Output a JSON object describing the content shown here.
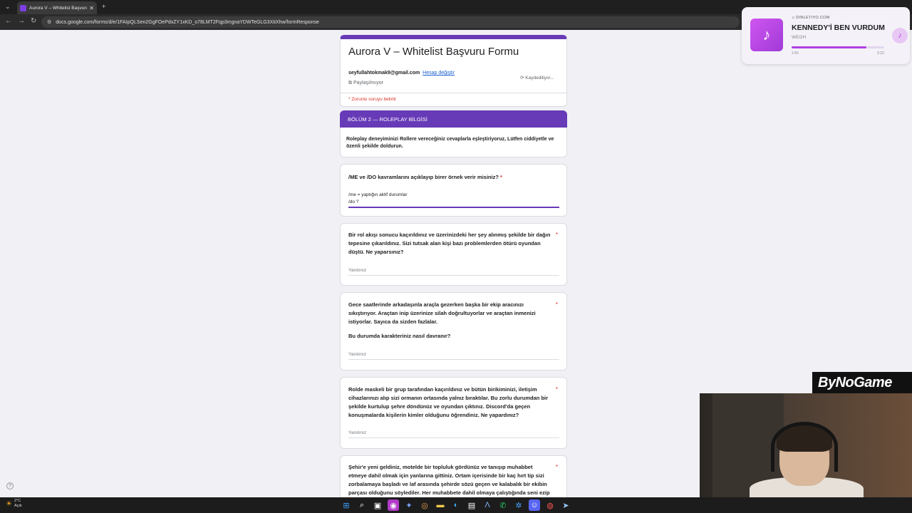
{
  "browser": {
    "tab_title": "Aurora V – Whitelist Başvuru Fo",
    "url": "docs.google.com/forms/d/e/1FAIpQLSen2GgFOePdxZY1xKD_o78LMT2Fqp3mgnaYDWTeGLG3XtiXhw/formResponse",
    "accent_color": "#673ab7"
  },
  "form": {
    "title": "Aurora V  – Whitelist Başvuru Formu",
    "email": "seyfullahtokmak9@gmail.com",
    "switch_account": "Hesap değiştir",
    "not_shared": "Paylaşılmıyor",
    "saving": "Kaydediliyor...",
    "required_note": "* Zorunlu soruyu belirtir",
    "section_title": "BÖLÜM 2 — ROLEPLAY BİLGİSİ",
    "section_description": "Roleplay deneyiminizi Rollere vereceğiniz cevaplarla eşleştiriyoruz, Lütfen ciddiyetle ve özenli şekilde doldurun.",
    "placeholder": "Yanıtınız",
    "required_star": "*",
    "questions": [
      {
        "text": "/ME ve /DO kavramlarını açıklayıp birer örnek verir misiniz?",
        "answer_line1": "/me = yaptığın aktif durumlar",
        "answer_line2": "/do ?"
      },
      {
        "text": "Bir rol akışı sonucu kaçırıldınız ve üzerinizdeki her şey alınmış şekilde bir dağın tepesine çıkarıldınız. Sizi tutsak alan kişi bazı problemlerden ötürü oyundan düştü. Ne yaparsınız?"
      },
      {
        "text": "Gece saatlerinde arkadaşınla araçla gezerken başka bir ekip aracınızı sıkıştırıyor. Araçtan inip üzerinize silah doğrultuyorlar ve araçtan inmenizi istiyorlar. Sayıca da sizden fazlalar.",
        "sub": "Bu durumda karakteriniz nasıl davranır?"
      },
      {
        "text": "Rolde maskeli bir grup tarafından kaçırıldınız ve bütün birikiminizi, iletişim cihazlarınızı alıp sizi ormanın ortasında yalnız bıraktılar. Bu zorlu durumdan bir şekilde kurtulup şehre döndünüz ve oyundan çıktınız. Discord'da geçen konuşmalarda kişilerin kimler olduğunu öğrendiniz. Ne yapardınız?"
      },
      {
        "text": "Şehir'e yeni geldiniz, motelde bir topluluk gördünüz ve tanışıp muhabbet etmeye dahil olmak için yanlarına gittiniz. Ortam içerisinde bir kaç hırt tip sizi zorbalamaya başladı ve laf arasında şehirde sözü geçen ve kalabalık bir ekibin parçası olduğunu söylediler. Her muhabbete dahil olmaya çalıştığında seni ezip"
      }
    ]
  },
  "music": {
    "source": "DINLETIYO.COM",
    "song": "KENNEDY'İ BEN VURDUM",
    "artist": "WEGH",
    "time_current": "1:55",
    "time_total": "2:22",
    "progress": 0.81
  },
  "overlay": {
    "brand": "ByNoGame"
  },
  "taskbar": {
    "temp": "2°C",
    "condition": "Açık"
  }
}
